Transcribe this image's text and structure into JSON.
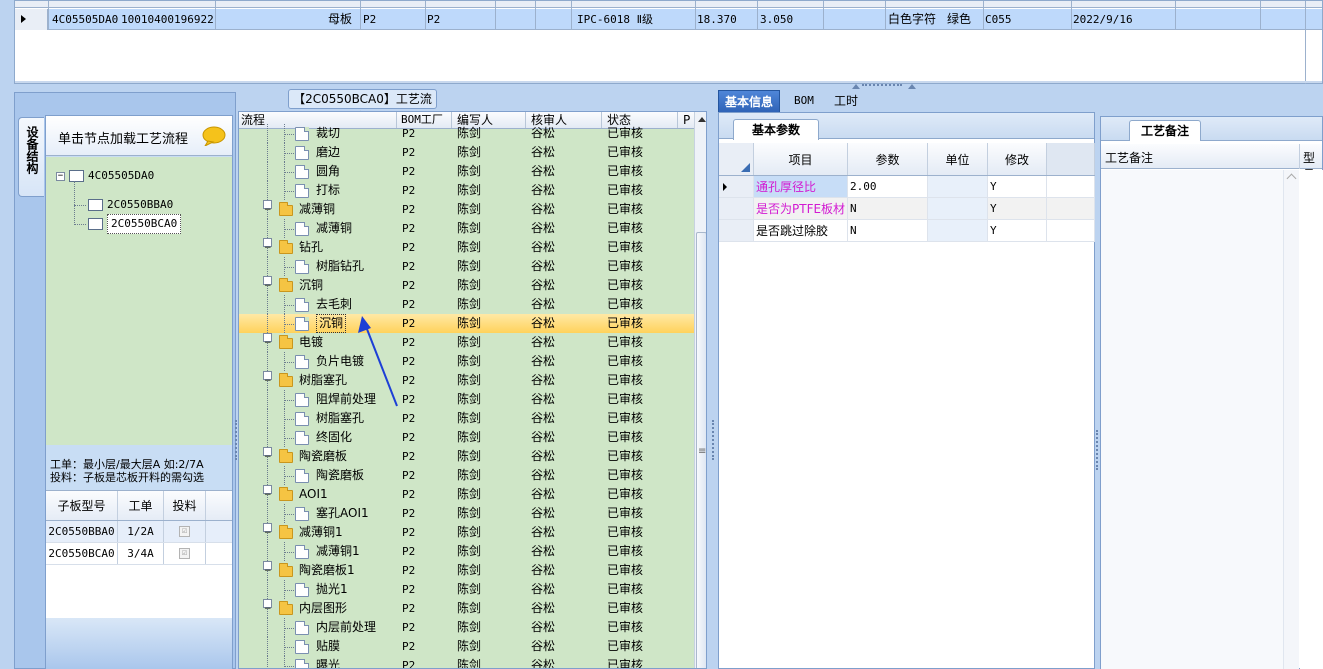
{
  "top_grid": {
    "row": {
      "col1": "4C05505DA0",
      "col2": "10010400196922",
      "col3": "母板",
      "col4": "P2",
      "col5": "P2",
      "col6": "IPC-6018 Ⅱ级",
      "col7": "18.370",
      "col8": "3.050",
      "col9": "白色字符",
      "col10": "绿色",
      "col11": "C055",
      "col12": "2022/9/16"
    }
  },
  "left_panel": {
    "side_tab": "设备结构",
    "header_text": "单击节点加载工艺流程",
    "tree": {
      "root": "4C05505DA0",
      "child1": "2C0550BBA0",
      "child2": "2C0550BCA0"
    },
    "info_line1": "工单：最小层/最大层A 如:2/7A",
    "info_line2": "投料：子板是芯板开料的需勾选",
    "table": {
      "headers": [
        "子板型号",
        "工单",
        "投料"
      ],
      "rows": [
        {
          "model": "2C0550BBA0",
          "order": "1/2A",
          "check": "☑"
        },
        {
          "model": "2C0550BCA0",
          "order": "3/4A",
          "check": "☑"
        }
      ]
    }
  },
  "flow": {
    "title": "【2C0550BCA0】工艺流程",
    "headers": {
      "name": "流程",
      "factory": "BOM工厂",
      "author": "编写人",
      "reviewer": "核审人",
      "status": "状态",
      "extra": "P"
    },
    "rows": [
      {
        "name": "裁切",
        "level": 2,
        "f": "P2",
        "a": "陈剑",
        "r": "谷松",
        "s": "已审核"
      },
      {
        "name": "磨边",
        "level": 2,
        "f": "P2",
        "a": "陈剑",
        "r": "谷松",
        "s": "已审核"
      },
      {
        "name": "圆角",
        "level": 2,
        "f": "P2",
        "a": "陈剑",
        "r": "谷松",
        "s": "已审核"
      },
      {
        "name": "打标",
        "level": 2,
        "f": "P2",
        "a": "陈剑",
        "r": "谷松",
        "s": "已审核"
      },
      {
        "name": "减薄铜",
        "level": 1,
        "f": "P2",
        "a": "陈剑",
        "r": "谷松",
        "s": "已审核"
      },
      {
        "name": "减薄铜",
        "level": 2,
        "f": "P2",
        "a": "陈剑",
        "r": "谷松",
        "s": "已审核"
      },
      {
        "name": "钻孔",
        "level": 1,
        "f": "P2",
        "a": "陈剑",
        "r": "谷松",
        "s": "已审核"
      },
      {
        "name": "树脂钻孔",
        "level": 2,
        "f": "P2",
        "a": "陈剑",
        "r": "谷松",
        "s": "已审核"
      },
      {
        "name": "沉铜",
        "level": 1,
        "f": "P2",
        "a": "陈剑",
        "r": "谷松",
        "s": "已审核"
      },
      {
        "name": "去毛刺",
        "level": 2,
        "f": "P2",
        "a": "陈剑",
        "r": "谷松",
        "s": "已审核"
      },
      {
        "name": "沉铜",
        "level": 2,
        "f": "P2",
        "a": "陈剑",
        "r": "谷松",
        "s": "已审核",
        "selected": true
      },
      {
        "name": "电镀",
        "level": 1,
        "f": "P2",
        "a": "陈剑",
        "r": "谷松",
        "s": "已审核"
      },
      {
        "name": "负片电镀",
        "level": 2,
        "f": "P2",
        "a": "陈剑",
        "r": "谷松",
        "s": "已审核"
      },
      {
        "name": "树脂塞孔",
        "level": 1,
        "f": "P2",
        "a": "陈剑",
        "r": "谷松",
        "s": "已审核"
      },
      {
        "name": "阻焊前处理",
        "level": 2,
        "f": "P2",
        "a": "陈剑",
        "r": "谷松",
        "s": "已审核"
      },
      {
        "name": "树脂塞孔",
        "level": 2,
        "f": "P2",
        "a": "陈剑",
        "r": "谷松",
        "s": "已审核"
      },
      {
        "name": "终固化",
        "level": 2,
        "f": "P2",
        "a": "陈剑",
        "r": "谷松",
        "s": "已审核"
      },
      {
        "name": "陶瓷磨板",
        "level": 1,
        "f": "P2",
        "a": "陈剑",
        "r": "谷松",
        "s": "已审核"
      },
      {
        "name": "陶瓷磨板",
        "level": 2,
        "f": "P2",
        "a": "陈剑",
        "r": "谷松",
        "s": "已审核"
      },
      {
        "name": "AOI1",
        "level": 1,
        "f": "P2",
        "a": "陈剑",
        "r": "谷松",
        "s": "已审核"
      },
      {
        "name": "塞孔AOI1",
        "level": 2,
        "f": "P2",
        "a": "陈剑",
        "r": "谷松",
        "s": "已审核"
      },
      {
        "name": "减薄铜1",
        "level": 1,
        "f": "P2",
        "a": "陈剑",
        "r": "谷松",
        "s": "已审核"
      },
      {
        "name": "减薄铜1",
        "level": 2,
        "f": "P2",
        "a": "陈剑",
        "r": "谷松",
        "s": "已审核"
      },
      {
        "name": "陶瓷磨板1",
        "level": 1,
        "f": "P2",
        "a": "陈剑",
        "r": "谷松",
        "s": "已审核"
      },
      {
        "name": "抛光1",
        "level": 2,
        "f": "P2",
        "a": "陈剑",
        "r": "谷松",
        "s": "已审核"
      },
      {
        "name": "内层图形",
        "level": 1,
        "f": "P2",
        "a": "陈剑",
        "r": "谷松",
        "s": "已审核"
      },
      {
        "name": "内层前处理",
        "level": 2,
        "f": "P2",
        "a": "陈剑",
        "r": "谷松",
        "s": "已审核"
      },
      {
        "name": "贴膜",
        "level": 2,
        "f": "P2",
        "a": "陈剑",
        "r": "谷松",
        "s": "已审核"
      },
      {
        "name": "曝光",
        "level": 2,
        "f": "P2",
        "a": "陈剑",
        "r": "谷松",
        "s": "已审核"
      }
    ]
  },
  "right_tabs": [
    "基本信息",
    "BOM",
    "工时"
  ],
  "basic": {
    "subtab": "基本参数",
    "headers": [
      "项目",
      "参数",
      "单位",
      "修改"
    ],
    "rows": [
      {
        "item": "通孔厚径比",
        "value": "2.00",
        "unit": "",
        "edit": "Y"
      },
      {
        "item": "是否为PTFE板材",
        "value": "N",
        "unit": "",
        "edit": "Y"
      },
      {
        "item": "是否跳过除胶",
        "value": "N",
        "unit": "",
        "edit": "Y"
      }
    ]
  },
  "remark": {
    "subtab": "工艺备注",
    "col1": "工艺备注",
    "col2": "型号"
  }
}
